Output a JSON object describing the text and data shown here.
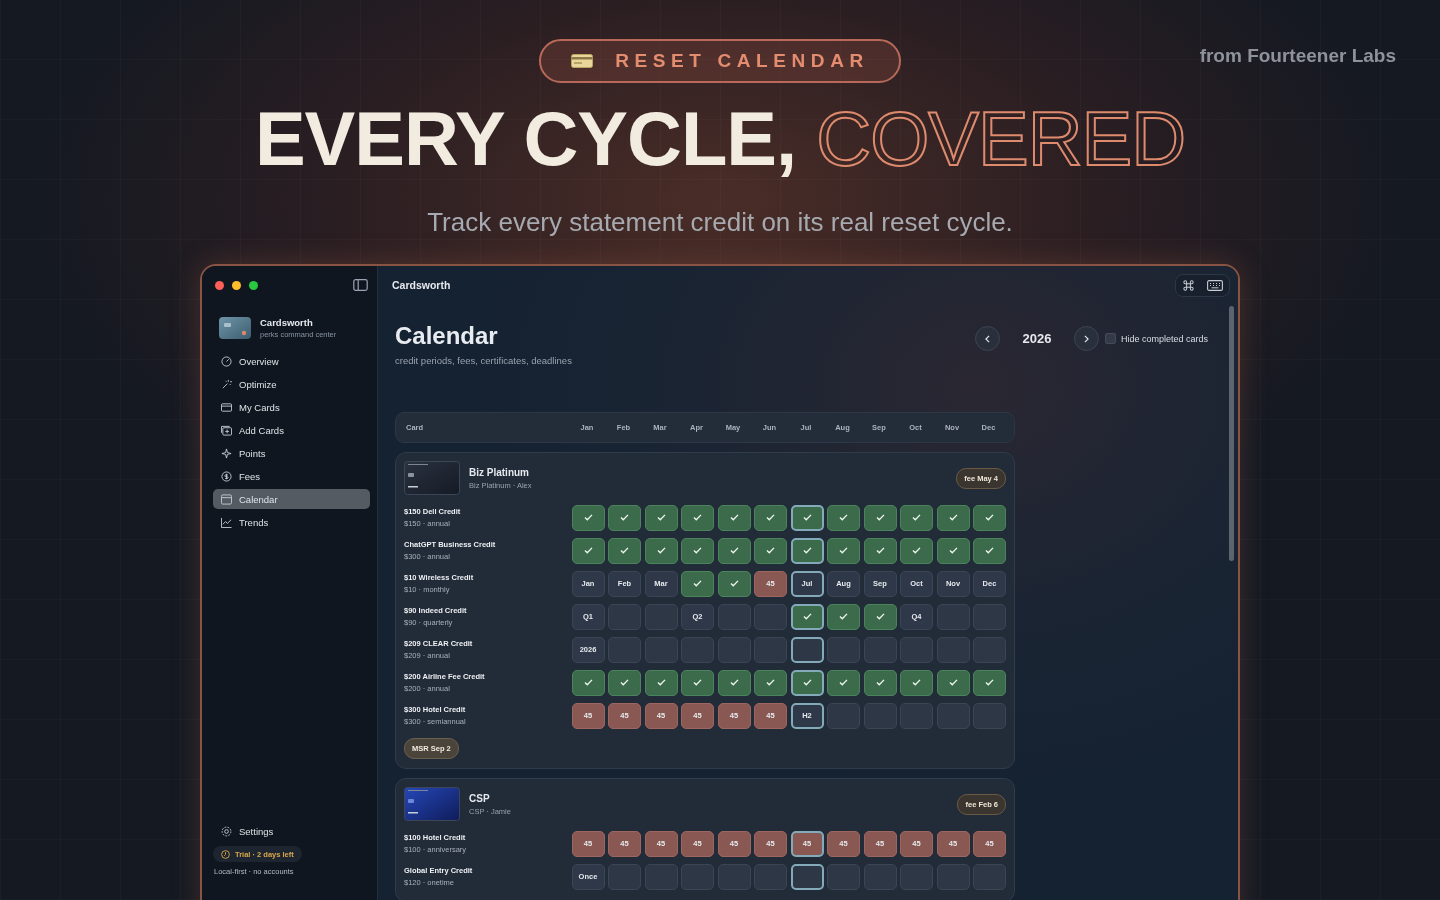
{
  "hero": {
    "badge": "RESET CALENDAR",
    "headline": "EVERY CYCLE,",
    "headline_outline": "COVERED",
    "subtitle": "Track every statement credit on its real reset cycle.",
    "credit_line": "from Fourteener Labs"
  },
  "window": {
    "title": "Cardsworth"
  },
  "sidebar": {
    "app_name": "Cardsworth",
    "app_tagline": "perks command center",
    "items": [
      {
        "label": "Overview",
        "selected": false
      },
      {
        "label": "Optimize",
        "selected": false
      },
      {
        "label": "My Cards",
        "selected": false
      },
      {
        "label": "Add Cards",
        "selected": false
      },
      {
        "label": "Points",
        "selected": false
      },
      {
        "label": "Fees",
        "selected": false
      },
      {
        "label": "Calendar",
        "selected": true
      },
      {
        "label": "Trends",
        "selected": false
      }
    ],
    "settings": "Settings",
    "trial": "Trial · 2 days left",
    "footer": "Local-first · no accounts"
  },
  "page": {
    "title": "Calendar",
    "subtitle": "credit periods, fees, certificates, deadlines",
    "year": "2026",
    "hide_completed": {
      "label": "Hide completed cards",
      "checked": false
    }
  },
  "table": {
    "card_column": "Card",
    "months": [
      {
        "label": "Jan",
        "current": false
      },
      {
        "label": "Feb",
        "current": false
      },
      {
        "label": "Mar",
        "current": false
      },
      {
        "label": "Apr",
        "current": false
      },
      {
        "label": "May",
        "current": false
      },
      {
        "label": "Jun",
        "current": false
      },
      {
        "label": "Jul",
        "current": true
      },
      {
        "label": "Aug",
        "current": false
      },
      {
        "label": "Sep",
        "current": false
      },
      {
        "label": "Oct",
        "current": false
      },
      {
        "label": "Nov",
        "current": false
      },
      {
        "label": "Dec",
        "current": false
      }
    ],
    "cards": [
      {
        "name": "Biz Platinum",
        "owner_line": "Biz Platinum · Alex",
        "fee": "fee May 4",
        "kind": "platinum",
        "badges": [
          "MSR Sep 2"
        ],
        "credits": [
          {
            "name": "$150 Dell Credit",
            "detail": "$150 · annual",
            "cells": [
              {
                "kind": "done"
              },
              {
                "kind": "done"
              },
              {
                "kind": "done"
              },
              {
                "kind": "done"
              },
              {
                "kind": "done"
              },
              {
                "kind": "done"
              },
              {
                "kind": "done"
              },
              {
                "kind": "done"
              },
              {
                "kind": "done"
              },
              {
                "kind": "done"
              },
              {
                "kind": "done"
              },
              {
                "kind": "done"
              }
            ]
          },
          {
            "name": "ChatGPT Business Credit",
            "detail": "$300 · annual",
            "cells": [
              {
                "kind": "done"
              },
              {
                "kind": "done"
              },
              {
                "kind": "done"
              },
              {
                "kind": "done"
              },
              {
                "kind": "done"
              },
              {
                "kind": "done"
              },
              {
                "kind": "done"
              },
              {
                "kind": "done"
              },
              {
                "kind": "done"
              },
              {
                "kind": "done"
              },
              {
                "kind": "done"
              },
              {
                "kind": "done"
              }
            ]
          },
          {
            "name": "$10 Wireless Credit",
            "detail": "$10 · monthly",
            "cells": [
              {
                "kind": "label",
                "text": "Jan"
              },
              {
                "kind": "label",
                "text": "Feb"
              },
              {
                "kind": "label",
                "text": "Mar"
              },
              {
                "kind": "done"
              },
              {
                "kind": "done"
              },
              {
                "kind": "missed",
                "text": "45"
              },
              {
                "kind": "label",
                "text": "Jul"
              },
              {
                "kind": "label",
                "text": "Aug"
              },
              {
                "kind": "label",
                "text": "Sep"
              },
              {
                "kind": "label",
                "text": "Oct"
              },
              {
                "kind": "label",
                "text": "Nov"
              },
              {
                "kind": "label",
                "text": "Dec"
              }
            ]
          },
          {
            "name": "$90 Indeed Credit",
            "detail": "$90 · quarterly",
            "cells": [
              {
                "kind": "label",
                "text": "Q1"
              },
              {
                "kind": "empty"
              },
              {
                "kind": "empty"
              },
              {
                "kind": "label",
                "text": "Q2"
              },
              {
                "kind": "empty"
              },
              {
                "kind": "empty"
              },
              {
                "kind": "done"
              },
              {
                "kind": "done"
              },
              {
                "kind": "done"
              },
              {
                "kind": "label",
                "text": "Q4"
              },
              {
                "kind": "empty"
              },
              {
                "kind": "empty"
              }
            ]
          },
          {
            "name": "$209 CLEAR Credit",
            "detail": "$209 · annual",
            "cells": [
              {
                "kind": "label",
                "text": "2026"
              },
              {
                "kind": "empty"
              },
              {
                "kind": "empty"
              },
              {
                "kind": "empty"
              },
              {
                "kind": "empty"
              },
              {
                "kind": "empty"
              },
              {
                "kind": "empty"
              },
              {
                "kind": "empty"
              },
              {
                "kind": "empty"
              },
              {
                "kind": "empty"
              },
              {
                "kind": "empty"
              },
              {
                "kind": "empty"
              }
            ]
          },
          {
            "name": "$200 Airline Fee Credit",
            "detail": "$200 · annual",
            "cells": [
              {
                "kind": "done"
              },
              {
                "kind": "done"
              },
              {
                "kind": "done"
              },
              {
                "kind": "done"
              },
              {
                "kind": "done"
              },
              {
                "kind": "done"
              },
              {
                "kind": "done"
              },
              {
                "kind": "done"
              },
              {
                "kind": "done"
              },
              {
                "kind": "done"
              },
              {
                "kind": "done"
              },
              {
                "kind": "done"
              }
            ]
          },
          {
            "name": "$300 Hotel Credit",
            "detail": "$300 · semiannual",
            "cells": [
              {
                "kind": "missed",
                "text": "45"
              },
              {
                "kind": "missed",
                "text": "45"
              },
              {
                "kind": "missed",
                "text": "45"
              },
              {
                "kind": "missed",
                "text": "45"
              },
              {
                "kind": "missed",
                "text": "45"
              },
              {
                "kind": "missed",
                "text": "45"
              },
              {
                "kind": "label",
                "text": "H2"
              },
              {
                "kind": "empty"
              },
              {
                "kind": "empty"
              },
              {
                "kind": "empty"
              },
              {
                "kind": "empty"
              },
              {
                "kind": "empty"
              }
            ]
          }
        ]
      },
      {
        "name": "CSP",
        "owner_line": "CSP · Jamie",
        "fee": "fee Feb 6",
        "kind": "sapphire",
        "credits": [
          {
            "name": "$100 Hotel Credit",
            "detail": "$100 · anniversary",
            "cells": [
              {
                "kind": "missed",
                "text": "45"
              },
              {
                "kind": "missed",
                "text": "45"
              },
              {
                "kind": "missed",
                "text": "45"
              },
              {
                "kind": "missed",
                "text": "45"
              },
              {
                "kind": "missed",
                "text": "45"
              },
              {
                "kind": "missed",
                "text": "45"
              },
              {
                "kind": "missed",
                "text": "45"
              },
              {
                "kind": "missed",
                "text": "45"
              },
              {
                "kind": "missed",
                "text": "45"
              },
              {
                "kind": "missed",
                "text": "45"
              },
              {
                "kind": "missed",
                "text": "45"
              },
              {
                "kind": "missed",
                "text": "45"
              }
            ]
          },
          {
            "name": "Global Entry Credit",
            "detail": "$120 · onetime",
            "cells": [
              {
                "kind": "label",
                "text": "Once"
              },
              {
                "kind": "empty"
              },
              {
                "kind": "empty"
              },
              {
                "kind": "empty"
              },
              {
                "kind": "empty"
              },
              {
                "kind": "empty"
              },
              {
                "kind": "empty"
              },
              {
                "kind": "empty"
              },
              {
                "kind": "empty"
              },
              {
                "kind": "empty"
              },
              {
                "kind": "empty"
              },
              {
                "kind": "empty"
              }
            ]
          }
        ]
      }
    ]
  }
}
